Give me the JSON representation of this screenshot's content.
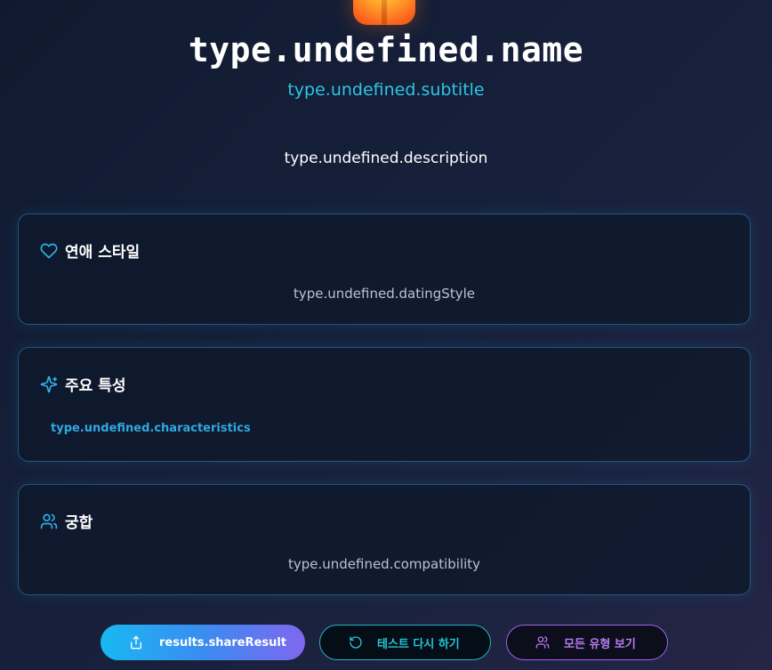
{
  "header": {
    "name": "type.undefined.name",
    "subtitle": "type.undefined.subtitle",
    "description": "type.undefined.description"
  },
  "cards": {
    "dating": {
      "title": "연애 스타일",
      "icon": "heart-icon",
      "text": "type.undefined.datingStyle"
    },
    "traits": {
      "title": "주요 특성",
      "icon": "sparkles-icon",
      "text": "type.undefined.characteristics"
    },
    "compat": {
      "title": "궁합",
      "icon": "users-icon",
      "text": "type.undefined.compatibility"
    }
  },
  "buttons": {
    "share": {
      "label": "results.shareResult",
      "icon": "share-icon"
    },
    "retry": {
      "label": "테스트 다시 하기",
      "icon": "refresh-icon"
    },
    "all_types": {
      "label": "모든 유형 보기",
      "icon": "users-icon"
    }
  },
  "colors": {
    "accent_cyan": "#2ec4e6",
    "accent_purple": "#9d62e8",
    "card_border": "#3ca0d2"
  }
}
